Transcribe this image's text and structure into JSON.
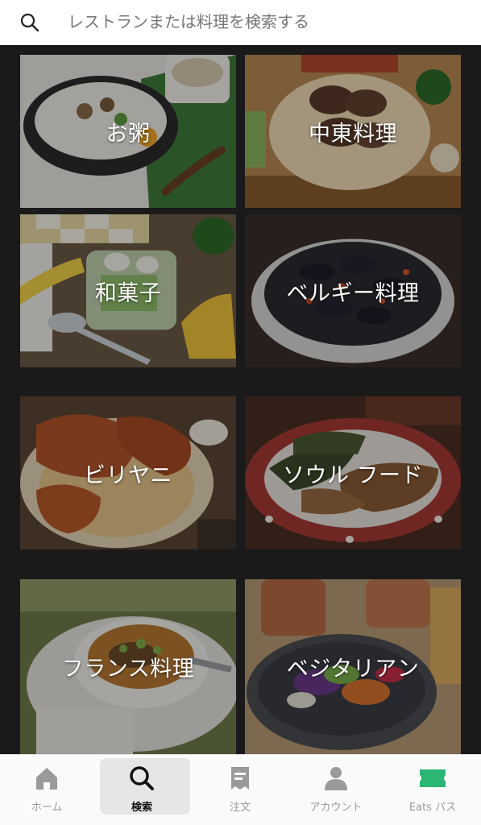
{
  "search": {
    "placeholder": "レストランまたは料理を検索する",
    "icon": "search-icon"
  },
  "categories": [
    {
      "label": "お粥",
      "theme": "congee"
    },
    {
      "label": "中東料理",
      "theme": "middle-eastern"
    },
    {
      "label": "和菓子",
      "theme": "wagashi"
    },
    {
      "label": "ベルギー料理",
      "theme": "belgian"
    },
    {
      "label": "ビリヤニ",
      "theme": "biryani"
    },
    {
      "label": "ソウル フード",
      "theme": "soul-food"
    },
    {
      "label": "フランス料理",
      "theme": "french"
    },
    {
      "label": "ベジタリアン",
      "theme": "vegetarian"
    }
  ],
  "nav": {
    "items": [
      {
        "label": "ホーム",
        "icon": "home-icon"
      },
      {
        "label": "検索",
        "icon": "search-icon",
        "active": true
      },
      {
        "label": "注文",
        "icon": "receipt-icon"
      },
      {
        "label": "アカウント",
        "icon": "account-icon"
      },
      {
        "label": "Eats パス",
        "icon": "ticket-icon"
      }
    ]
  },
  "colors": {
    "accent_green": "#2bb673",
    "nav_inactive": "#9a9a9a",
    "nav_active": "#111111"
  }
}
